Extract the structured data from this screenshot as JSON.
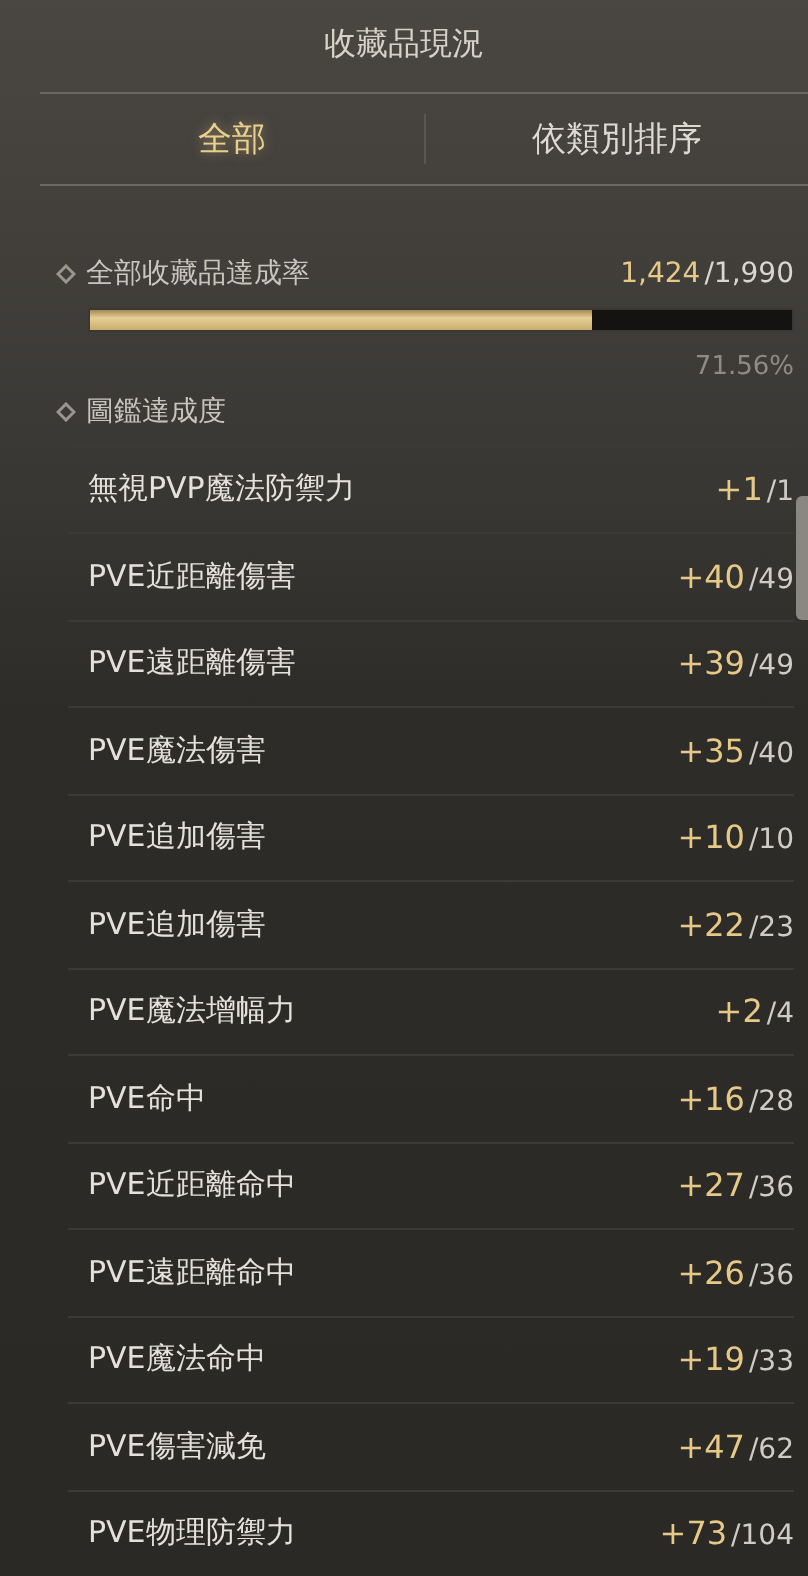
{
  "title": "收藏品現況",
  "tabs": [
    {
      "label": "全部",
      "selected": true
    },
    {
      "label": "依類別排序",
      "selected": false
    }
  ],
  "overall": {
    "label": "全部收藏品達成率",
    "count": "1,424",
    "total": "/1,990",
    "level": 0.7156,
    "percent": "71.56%"
  },
  "section": {
    "label": "圖鑑達成度"
  },
  "rows": [
    {
      "label": "無視PVP魔法防禦力",
      "gain": "+1",
      "total": "/1"
    },
    {
      "label": "PVE近距離傷害",
      "gain": "+40",
      "total": "/49"
    },
    {
      "label": "PVE遠距離傷害",
      "gain": "+39",
      "total": "/49"
    },
    {
      "label": "PVE魔法傷害",
      "gain": "+35",
      "total": "/40"
    },
    {
      "label": "PVE追加傷害",
      "gain": "+10",
      "total": "/10"
    },
    {
      "label": "PVE追加傷害",
      "gain": "+22",
      "total": "/23"
    },
    {
      "label": "PVE魔法增幅力",
      "gain": "+2",
      "total": "/4"
    },
    {
      "label": "PVE命中",
      "gain": "+16",
      "total": "/28"
    },
    {
      "label": "PVE近距離命中",
      "gain": "+27",
      "total": "/36"
    },
    {
      "label": "PVE遠距離命中",
      "gain": "+26",
      "total": "/36"
    },
    {
      "label": "PVE魔法命中",
      "gain": "+19",
      "total": "/33"
    },
    {
      "label": "PVE傷害減免",
      "gain": "+47",
      "total": "/62"
    },
    {
      "label": "PVE物理防禦力",
      "gain": "+73",
      "total": "/104"
    }
  ]
}
